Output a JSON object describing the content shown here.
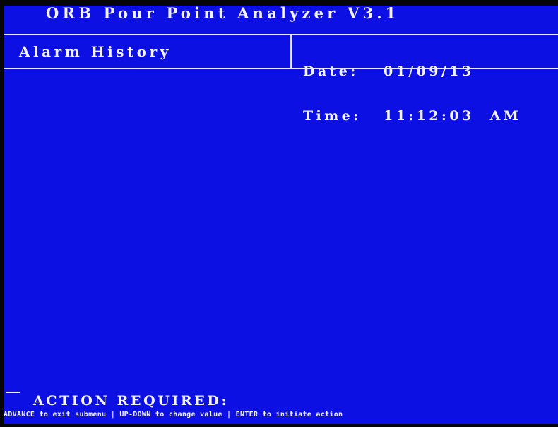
{
  "app": {
    "title": "ORB Pour Point Analyzer V3.1"
  },
  "header": {
    "screen_name": "Alarm History",
    "date_label": "Date:",
    "date_value": "01/09/13",
    "time_label": "Time:",
    "time_value": "11:12:03",
    "time_ampm": "AM"
  },
  "content": {
    "items": []
  },
  "footer": {
    "action_label": "ACTION REQUIRED:",
    "hint": "ADVANCE to exit submenu | UP-DOWN to change value | ENTER to initiate action"
  },
  "colors": {
    "background": "#0d10e3",
    "text": "#f2f2ff",
    "bezel": "#050505"
  }
}
